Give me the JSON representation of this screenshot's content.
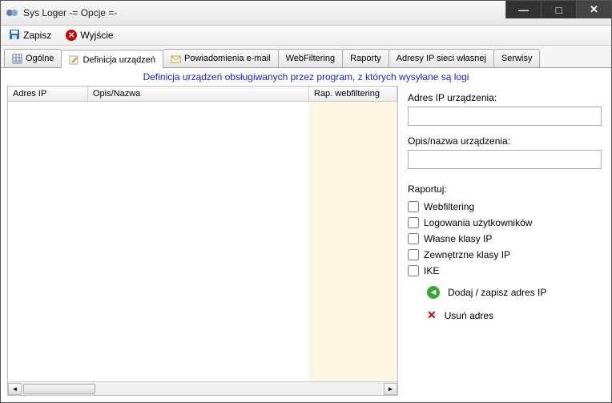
{
  "window": {
    "title": "Sys Loger -= Opcje =-"
  },
  "toolbar": {
    "save": "Zapisz",
    "exit": "Wyjście"
  },
  "tabs": {
    "general": "Ogólne",
    "devices": "Definicja urządzeń",
    "email": "Powiadomienia e-mail",
    "webfiltering": "WebFiltering",
    "reports": "Raporty",
    "ownips": "Adresy IP sieci własnej",
    "services": "Serwisy"
  },
  "page": {
    "description": "Definicja urządzeń obsługiwanych przez program, z których wysyłane są logi",
    "columns": {
      "ip": "Adres IP",
      "name": "Opis/Nazwa",
      "rap": "Rap. webfiltering"
    }
  },
  "form": {
    "ip_label": "Adres IP urządzenia:",
    "ip_value": "",
    "name_label": "Opis/nazwa urządzenia:",
    "name_value": "",
    "report_label": "Raportuj:",
    "cb_webfiltering": "Webfiltering",
    "cb_logins": "Logowania użytkowników",
    "cb_own_classes": "Własne klasy IP",
    "cb_ext_classes": "Zewnętrzne klasy IP",
    "cb_ike": "IKE",
    "btn_add": "Dodaj / zapisz adres IP",
    "btn_del": "Usuń adres"
  }
}
